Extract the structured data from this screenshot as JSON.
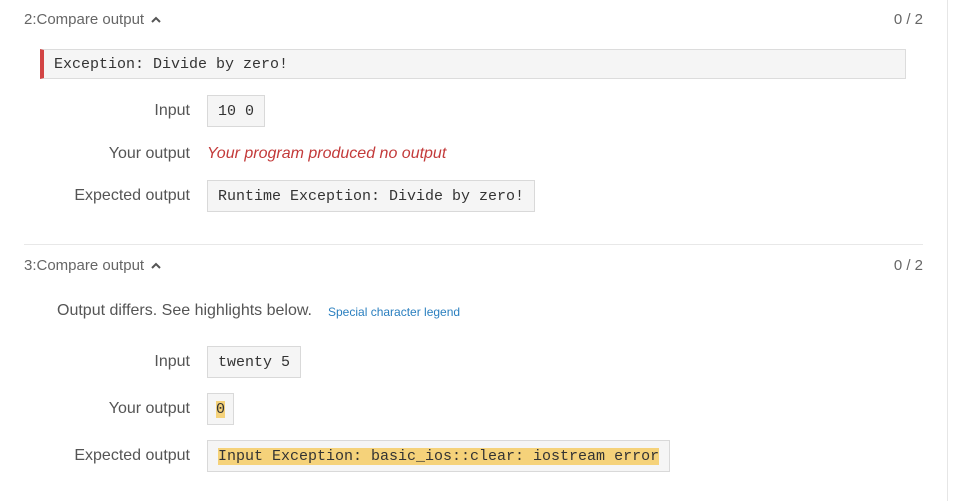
{
  "sections": [
    {
      "title": "2:Compare output",
      "score": "0 / 2",
      "error_message": "Exception: Divide by zero!",
      "input_label": "Input",
      "input_value": "10 0",
      "your_output_label": "Your output",
      "your_output_value": "Your program produced no output",
      "expected_output_label": "Expected output",
      "expected_output_value": "Runtime Exception: Divide by zero!"
    },
    {
      "title": "3:Compare output",
      "score": "0 / 2",
      "diff_message": "Output differs. See highlights below.",
      "legend_link": "Special character legend",
      "input_label": "Input",
      "input_value": "twenty 5",
      "your_output_label": "Your output",
      "your_output_value": "0",
      "expected_output_label": "Expected output",
      "expected_output_value": "Input Exception: basic_ios::clear: iostream error"
    }
  ],
  "icons": {
    "collapse": "chevron-up-icon"
  },
  "colors": {
    "error_accent": "#d24444",
    "no_output_text": "#c33a3a",
    "highlight": "#f5d27a",
    "link": "#2a7fbf"
  }
}
